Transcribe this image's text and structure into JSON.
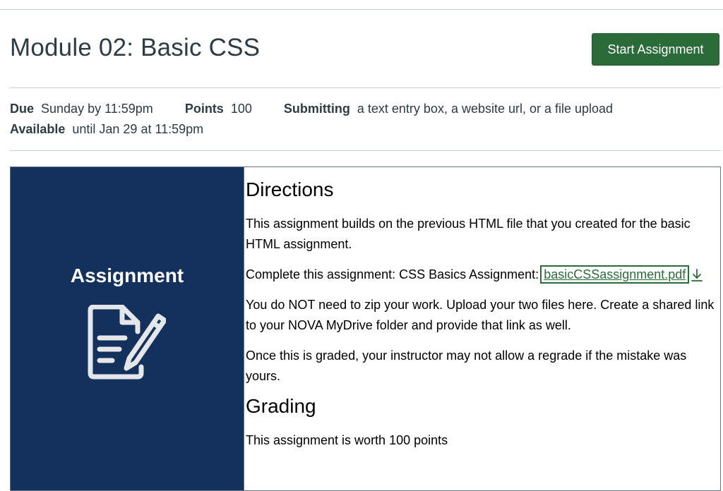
{
  "header": {
    "title": "Module 02: Basic CSS",
    "start_button": "Start Assignment"
  },
  "details": {
    "due_label": "Due",
    "due_value": "Sunday by 11:59pm",
    "points_label": "Points",
    "points_value": "100",
    "submitting_label": "Submitting",
    "submitting_value": "a text entry box, a website url, or a file upload",
    "available_label": "Available",
    "available_value": "until Jan 29 at 11:59pm"
  },
  "banner": {
    "label": "Assignment",
    "icon": "assignment-edit-icon",
    "color": "#14305c"
  },
  "content": {
    "directions_heading": "Directions",
    "p1": "This assignment builds on the previous HTML file that you created for the basic HTML assignment.",
    "p2_prefix": "Complete this assignment: CSS Basics Assignment: ",
    "file_link": "basicCSSassignment.pdf",
    "p3": "You do NOT need to zip your work. Upload your two files here. Create a shared link to your NOVA MyDrive folder and provide that link as well.",
    "p4": "Once this is graded, your instructor may not allow a regrade if the mistake was yours.",
    "grading_heading": "Grading",
    "p5": "This assignment is worth 100 points"
  },
  "colors": {
    "accent_green": "#2b6b3a",
    "text": "#2d3b45"
  }
}
